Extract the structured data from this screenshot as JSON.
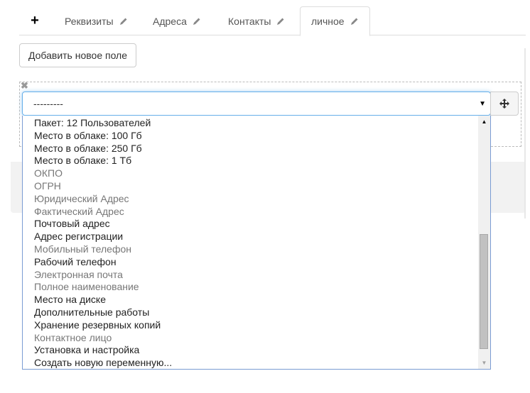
{
  "tabs": {
    "add_symbol": "+",
    "items": [
      {
        "label": "Реквизиты",
        "icon": "pencil-icon"
      },
      {
        "label": "Адреса",
        "icon": "pencil-icon"
      },
      {
        "label": "Контакты",
        "icon": "pencil-icon"
      },
      {
        "label": "личное",
        "icon": "pencil-icon",
        "active": true
      }
    ]
  },
  "add_field_button": "Добавить новое поле",
  "field": {
    "remove_symbol": "✖",
    "select_value": "---------",
    "move_icon": "arrows-move-icon"
  },
  "dropdown": {
    "options": [
      {
        "label": "Пакет: 12 Пользователей",
        "enabled": true
      },
      {
        "label": "Место в облаке: 100 Гб",
        "enabled": true
      },
      {
        "label": "Место в облаке: 250 Гб",
        "enabled": true
      },
      {
        "label": "Место в облаке: 1 Тб",
        "enabled": true
      },
      {
        "label": "ОКПО",
        "enabled": false
      },
      {
        "label": "ОГРН",
        "enabled": false
      },
      {
        "label": "Юридический Адрес",
        "enabled": false
      },
      {
        "label": "Фактический Адрес",
        "enabled": false
      },
      {
        "label": "Почтовый адрес",
        "enabled": true
      },
      {
        "label": "Адрес регистрации",
        "enabled": true
      },
      {
        "label": "Мобильный телефон",
        "enabled": false
      },
      {
        "label": "Рабочий телефон",
        "enabled": true
      },
      {
        "label": "Электронная почта",
        "enabled": false
      },
      {
        "label": "Полное наименование",
        "enabled": false
      },
      {
        "label": "Место на диске",
        "enabled": true
      },
      {
        "label": "Дополнительные работы",
        "enabled": true
      },
      {
        "label": "Хранение резервных копий",
        "enabled": true
      },
      {
        "label": "Контактное лицо",
        "enabled": false
      },
      {
        "label": "Установка и настройка",
        "enabled": true
      },
      {
        "label": "Создать новую переменную...",
        "enabled": true
      }
    ],
    "scroll_position": 0.93,
    "visible_fraction": 0.5
  },
  "colors": {
    "focus_border": "#66afe9",
    "disabled_text": "#777777",
    "enabled_text": "#222222"
  }
}
